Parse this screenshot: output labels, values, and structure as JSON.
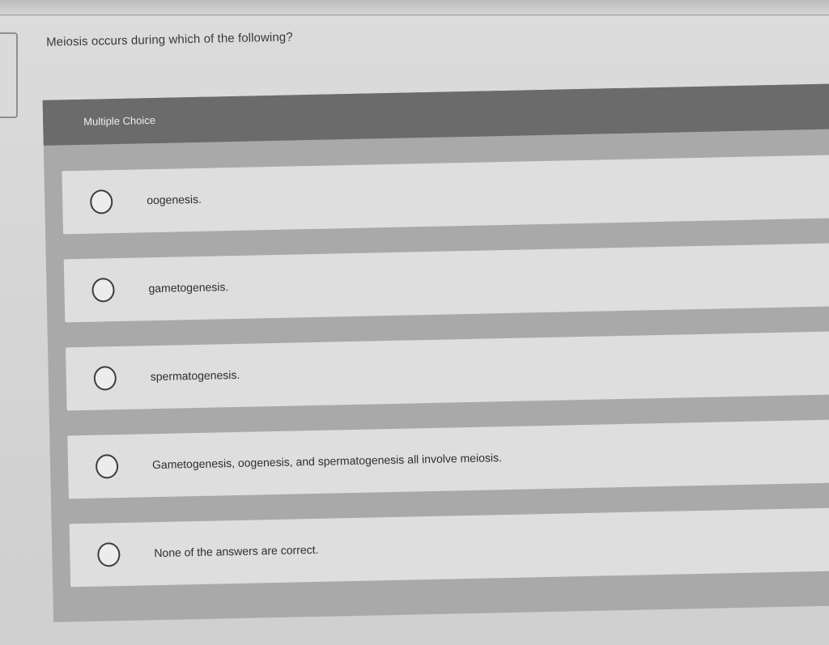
{
  "question": {
    "text": "Meiosis occurs during which of the following?"
  },
  "multiple_choice": {
    "header_label": "Multiple Choice",
    "options": [
      {
        "label": "oogenesis."
      },
      {
        "label": "gametogenesis."
      },
      {
        "label": "spermatogenesis."
      },
      {
        "label": "Gametogenesis, oogenesis, and spermatogenesis all involve meiosis."
      },
      {
        "label": "None of the answers are correct."
      }
    ]
  },
  "colors": {
    "header_bar": "#6b6b6b",
    "panel_background": "#a9a9a9",
    "option_background": "#dedede",
    "page_background": "#d6d6d6"
  },
  "icons": {
    "option_selector": "radio-icon"
  }
}
